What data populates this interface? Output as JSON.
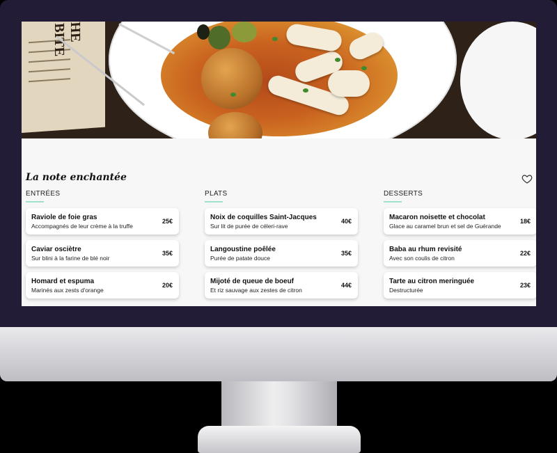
{
  "restaurant": {
    "title": "La note enchantée",
    "menu_card_text": "HE BITE"
  },
  "colors": {
    "bezel": "#221c36",
    "accent_underline": "#9fe0cf",
    "screen_background": "#f7f7f7"
  },
  "icons": {
    "favorite": "heart-icon"
  },
  "sections": [
    {
      "title": "ENTRÉES",
      "items": [
        {
          "name": "Raviole de foie gras",
          "description": "Accompagnés de leur crème à la truffe",
          "price": "25€"
        },
        {
          "name": "Caviar osciètre",
          "description": "Sur blini à la farine de blé noir",
          "price": "35€"
        },
        {
          "name": "Homard et espuma",
          "description": "Marinés aux zests d'orange",
          "price": "20€"
        }
      ]
    },
    {
      "title": "PLATS",
      "items": [
        {
          "name": "Noix de coquilles Saint-Jacques",
          "description": "Sur lit de purée de céleri-rave",
          "price": "40€"
        },
        {
          "name": "Langoustine poêlée",
          "description": "Purée de patate douce",
          "price": "35€"
        },
        {
          "name": "Mijoté de queue de boeuf",
          "description": "Et riz sauvage aux zestes de citron",
          "price": "44€"
        }
      ]
    },
    {
      "title": "DESSERTS",
      "items": [
        {
          "name": "Macaron noisette et chocolat",
          "description": "Glace au caramel brun et sel de Guérande",
          "price": "18€"
        },
        {
          "name": "Baba au rhum revisité",
          "description": "Avec son coulis de citron",
          "price": "22€"
        },
        {
          "name": "Tarte au citron meringuée",
          "description": "Destructurée",
          "price": "23€"
        }
      ]
    }
  ]
}
